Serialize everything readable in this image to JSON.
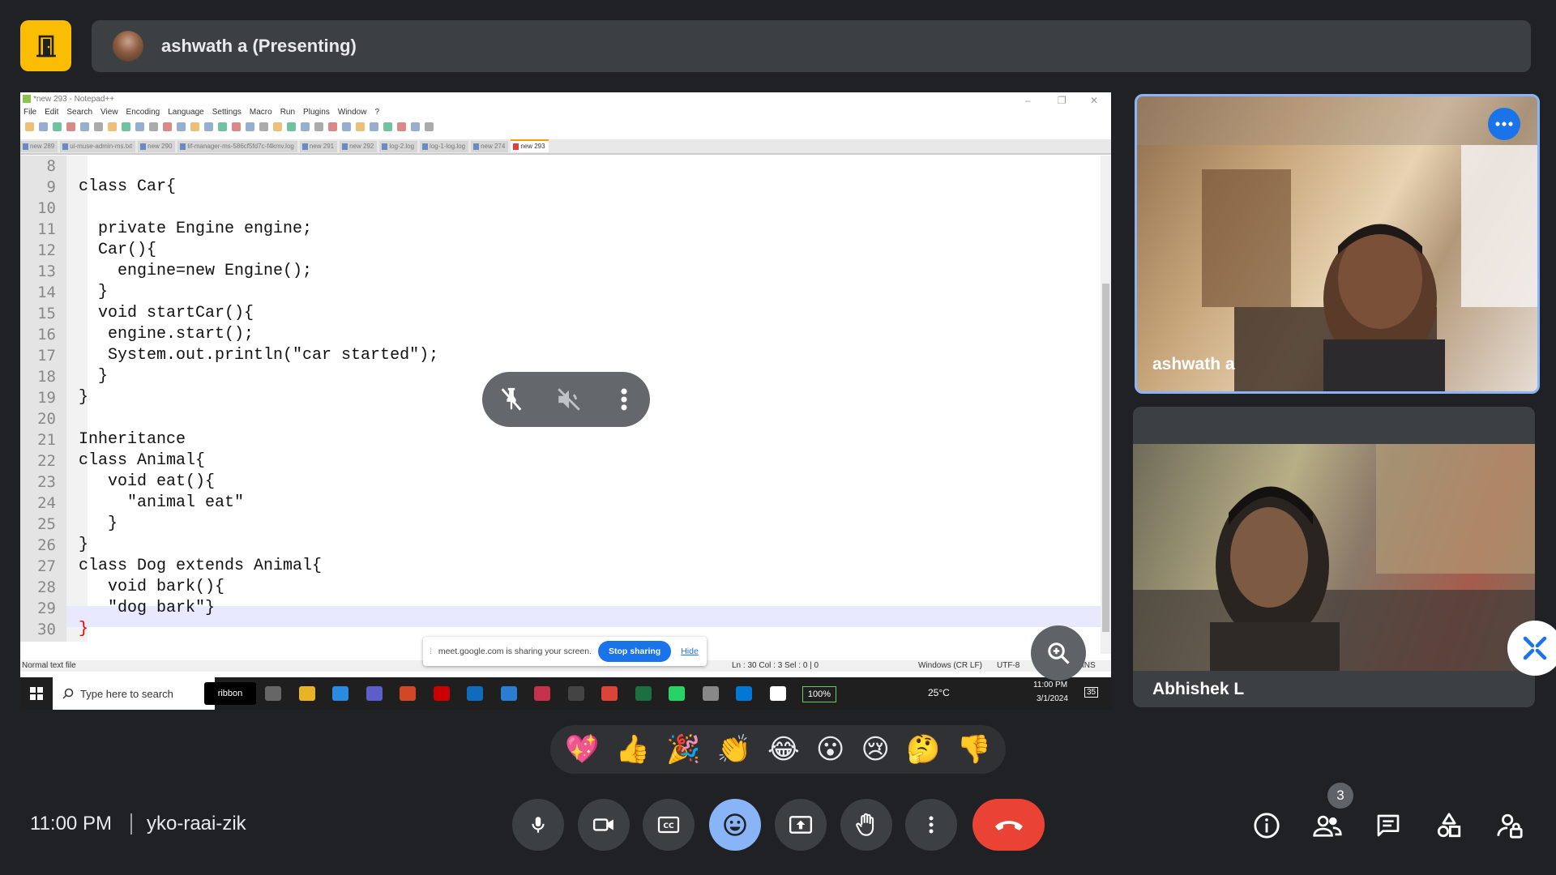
{
  "meeting": {
    "presenter_label": "ashwath a (Presenting)",
    "time": "11:00 PM",
    "code": "yko-raai-zik",
    "people_count": "3"
  },
  "shared_screen": {
    "window_title": "*new 293 - Notepad++",
    "menu": [
      "File",
      "Edit",
      "Search",
      "View",
      "Encoding",
      "Language",
      "Settings",
      "Macro",
      "Run",
      "Plugins",
      "Window",
      "?"
    ],
    "tabs": [
      "new 289",
      "ui-muse-admin-ms.txt",
      "new 290",
      "lif-manager-ms-586cf5fd7c-f4kmv.log",
      "new 291",
      "new 292",
      "log-2.log",
      "log-1-log.log",
      "new 274",
      "new 293"
    ],
    "active_tab": "new 293",
    "lines": [
      {
        "n": "8",
        "text": ""
      },
      {
        "n": "9",
        "text": "class Car{"
      },
      {
        "n": "10",
        "text": ""
      },
      {
        "n": "11",
        "text": "  private Engine engine;"
      },
      {
        "n": "12",
        "text": "  Car(){"
      },
      {
        "n": "13",
        "text": "    engine=new Engine();"
      },
      {
        "n": "14",
        "text": "  }"
      },
      {
        "n": "15",
        "text": "  void startCar(){"
      },
      {
        "n": "16",
        "text": "   engine.start();"
      },
      {
        "n": "17",
        "text": "   System.out.println(\"car started\");"
      },
      {
        "n": "18",
        "text": "  }"
      },
      {
        "n": "19",
        "text": "}"
      },
      {
        "n": "20",
        "text": ""
      },
      {
        "n": "21",
        "text": "Inheritance"
      },
      {
        "n": "22",
        "text": "class Animal{"
      },
      {
        "n": "23",
        "text": "   void eat(){"
      },
      {
        "n": "24",
        "text": "     \"animal eat\""
      },
      {
        "n": "25",
        "text": "   }"
      },
      {
        "n": "26",
        "text": "}"
      },
      {
        "n": "27",
        "text": "class Dog extends Animal{"
      },
      {
        "n": "28",
        "text": "   void bark(){"
      },
      {
        "n": "29",
        "text": "   \"dog bark\"}"
      },
      {
        "n": "30",
        "text": "}"
      }
    ],
    "status": {
      "file_type": "Normal text file",
      "position": "Ln : 30    Col : 3    Sel : 0 | 0",
      "eol": "Windows (CR LF)",
      "encoding": "UTF-8",
      "mode": "INS"
    },
    "share_banner": {
      "text": "meet.google.com is sharing your screen.",
      "stop_label": "Stop sharing",
      "hide_label": "Hide"
    },
    "taskbar": {
      "search_placeholder": "Type here to search",
      "search_app": "ribbon",
      "battery": "100%",
      "weather": "25°C",
      "time": "11:00 PM",
      "date": "3/1/2024",
      "notifications": "35"
    }
  },
  "participants": [
    {
      "name": "ashwath a"
    },
    {
      "name": "Abhishek L"
    }
  ],
  "reactions": [
    "💖",
    "👍",
    "🎉",
    "👏",
    "😂",
    "😮",
    "😢",
    "🤔",
    "👎"
  ],
  "colors": {
    "accent_blue": "#8ab4f8",
    "meet_blue": "#1a73e8",
    "end_call_red": "#ea4335",
    "door_yellow": "#fbbc04"
  }
}
